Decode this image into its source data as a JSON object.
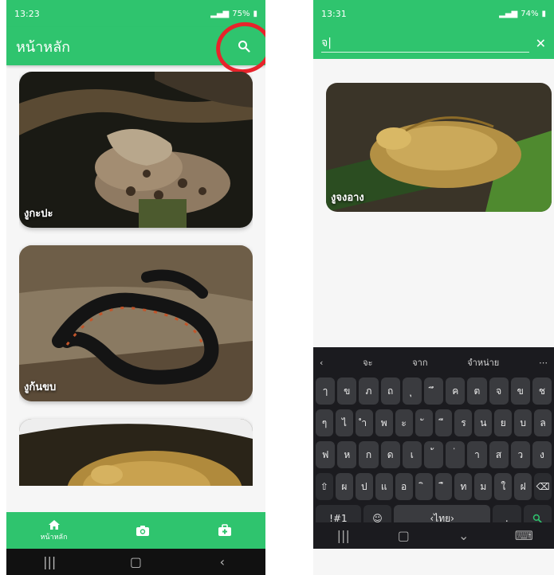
{
  "left_screen": {
    "status": {
      "time": "13:23",
      "battery": "75%"
    },
    "app_title": "หน้าหลัก",
    "cards": [
      {
        "label": "งูกะปะ"
      },
      {
        "label": "งูก้นขบ"
      },
      {
        "label": ""
      }
    ],
    "bottom_nav": [
      {
        "label": "หน้าหลัก",
        "icon": "home-icon"
      },
      {
        "label": "",
        "icon": "camera-icon"
      },
      {
        "label": "",
        "icon": "first-aid-icon"
      }
    ]
  },
  "right_screen": {
    "status": {
      "time": "13:31",
      "battery": "74%"
    },
    "search_value": "จ|",
    "result_card": {
      "label": "งูจงอาง"
    },
    "keyboard": {
      "suggestions": [
        "จะ",
        "จาก",
        "จำหน่าย"
      ],
      "rows": [
        [
          "ๅ",
          "ข",
          "ภ",
          "ถ",
          "ุ",
          "ึ",
          "ค",
          "ต",
          "จ",
          "ข",
          "ช"
        ],
        [
          "ๆ",
          "ไ",
          "ำ",
          "พ",
          "ะ",
          "ั",
          "ี",
          "ร",
          "น",
          "ย",
          "บ",
          "ล"
        ],
        [
          "ฟ",
          "ห",
          "ก",
          "ด",
          "เ",
          "้",
          "่",
          "า",
          "ส",
          "ว",
          "ง"
        ],
        [
          "ผ",
          "ป",
          "แ",
          "อ",
          "ิ",
          "ื",
          "ท",
          "ม",
          "ใ",
          "ฝ"
        ]
      ],
      "bottom_row": [
        "!#1",
        "ไทย"
      ]
    }
  },
  "colors": {
    "accent": "#2fc46e",
    "highlight": "#e8232b"
  }
}
